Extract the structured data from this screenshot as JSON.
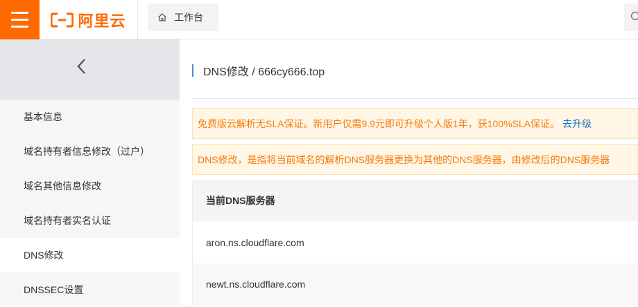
{
  "header": {
    "logo_text": "阿里云",
    "workbench_label": "工作台",
    "brand_color": "#ff6a00"
  },
  "sidebar": {
    "items": [
      {
        "label": "基本信息"
      },
      {
        "label": "域名持有者信息修改（过户）"
      },
      {
        "label": "域名其他信息修改"
      },
      {
        "label": "域名持有者实名认证"
      },
      {
        "label": "DNS修改",
        "active": true
      },
      {
        "label": "DNSSEC设置"
      }
    ]
  },
  "main": {
    "title": "DNS修改 / 666cy666.top",
    "notice_upgrade": {
      "text": "免费版云解析无SLA保证。新用户仅需9.9元即可升级个人版1年，获100%SLA保证。",
      "link": "去升级"
    },
    "notice_dns": {
      "text": "DNS修改，是指将当前域名的解析DNS服务器更换为其他的DNS服务器，由修改后的DNS服务器"
    },
    "table": {
      "header": "当前DNS服务器",
      "rows": [
        {
          "value": "aron.ns.cloudflare.com"
        },
        {
          "value": "newt.ns.cloudflare.com"
        }
      ]
    }
  }
}
